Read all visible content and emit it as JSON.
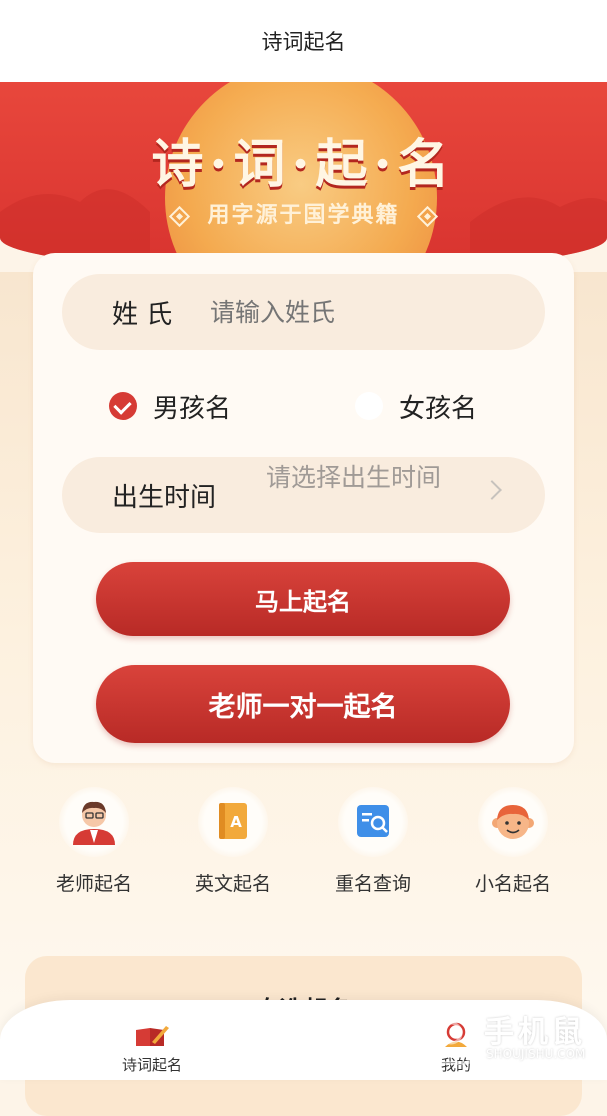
{
  "header": {
    "title": "诗词起名"
  },
  "banner": {
    "title": "诗·词·起·名",
    "subtitle": "用字源于国学典籍"
  },
  "form": {
    "surname_label": "姓 氏",
    "surname_placeholder": "请输入姓氏",
    "gender_options": [
      {
        "label": "男孩名",
        "selected": true
      },
      {
        "label": "女孩名",
        "selected": false
      }
    ],
    "birth_label": "出生时间",
    "birth_placeholder": "请选择出生时间",
    "primary_button": "马上起名",
    "secondary_button": "老师一对一起名"
  },
  "quick_actions": [
    {
      "label": "老师起名",
      "icon": "teacher-icon"
    },
    {
      "label": "英文起名",
      "icon": "english-name-icon"
    },
    {
      "label": "重名查询",
      "icon": "search-duplicate-icon"
    },
    {
      "label": "小名起名",
      "icon": "child-face-icon"
    }
  ],
  "section": {
    "title": "自选起名"
  },
  "tabbar": {
    "items": [
      {
        "label": "诗词起名",
        "icon": "poetry-name-icon",
        "active": true
      },
      {
        "label": "我的",
        "icon": "profile-icon",
        "active": false
      }
    ]
  },
  "watermark": {
    "text": "手机鼠",
    "sub": "SHOUJISHU.COM"
  },
  "colors": {
    "accent": "#d63b35",
    "banner": "#e04338",
    "card": "#fffaf4",
    "pill": "#f9ecde"
  }
}
